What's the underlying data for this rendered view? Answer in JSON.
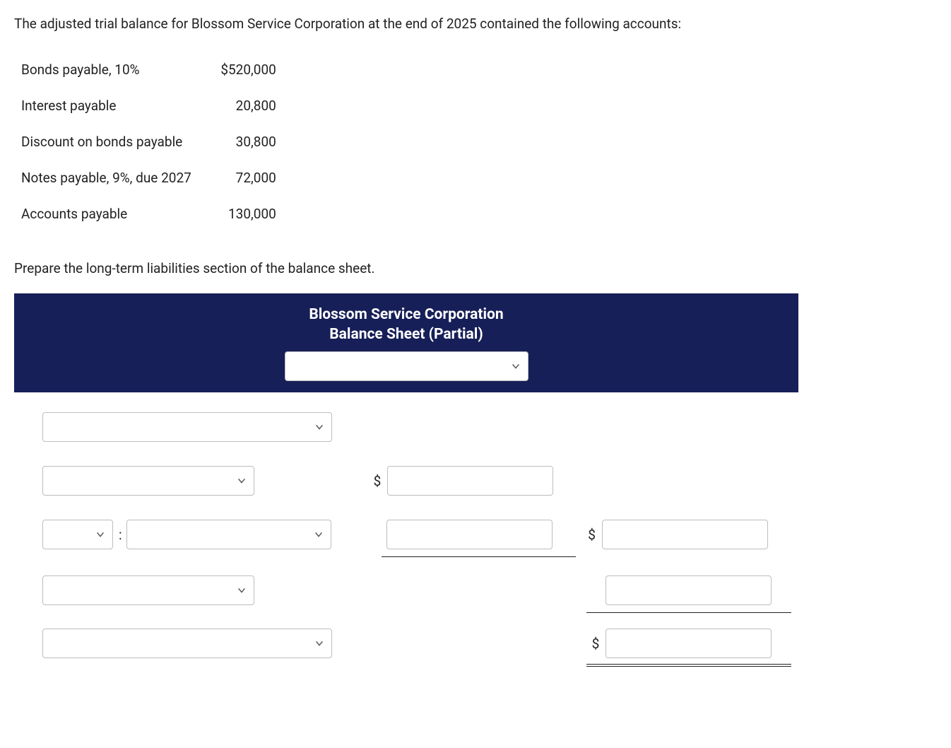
{
  "intro": "The adjusted trial balance for Blossom Service Corporation at the end of 2025 contained the following accounts:",
  "accounts": [
    {
      "name": "Bonds payable, 10%",
      "amount": "$520,000"
    },
    {
      "name": "Interest payable",
      "amount": "20,800"
    },
    {
      "name": "Discount on bonds payable",
      "amount": "30,800"
    },
    {
      "name": "Notes payable, 9%, due 2027",
      "amount": "72,000"
    },
    {
      "name": "Accounts payable",
      "amount": "130,000"
    }
  ],
  "instruction": "Prepare the long-term liabilities section of the balance sheet.",
  "header": {
    "line1": "Blossom Service Corporation",
    "line2": "Balance Sheet (Partial)"
  },
  "labels": {
    "colon": ":",
    "dollar": "$"
  }
}
